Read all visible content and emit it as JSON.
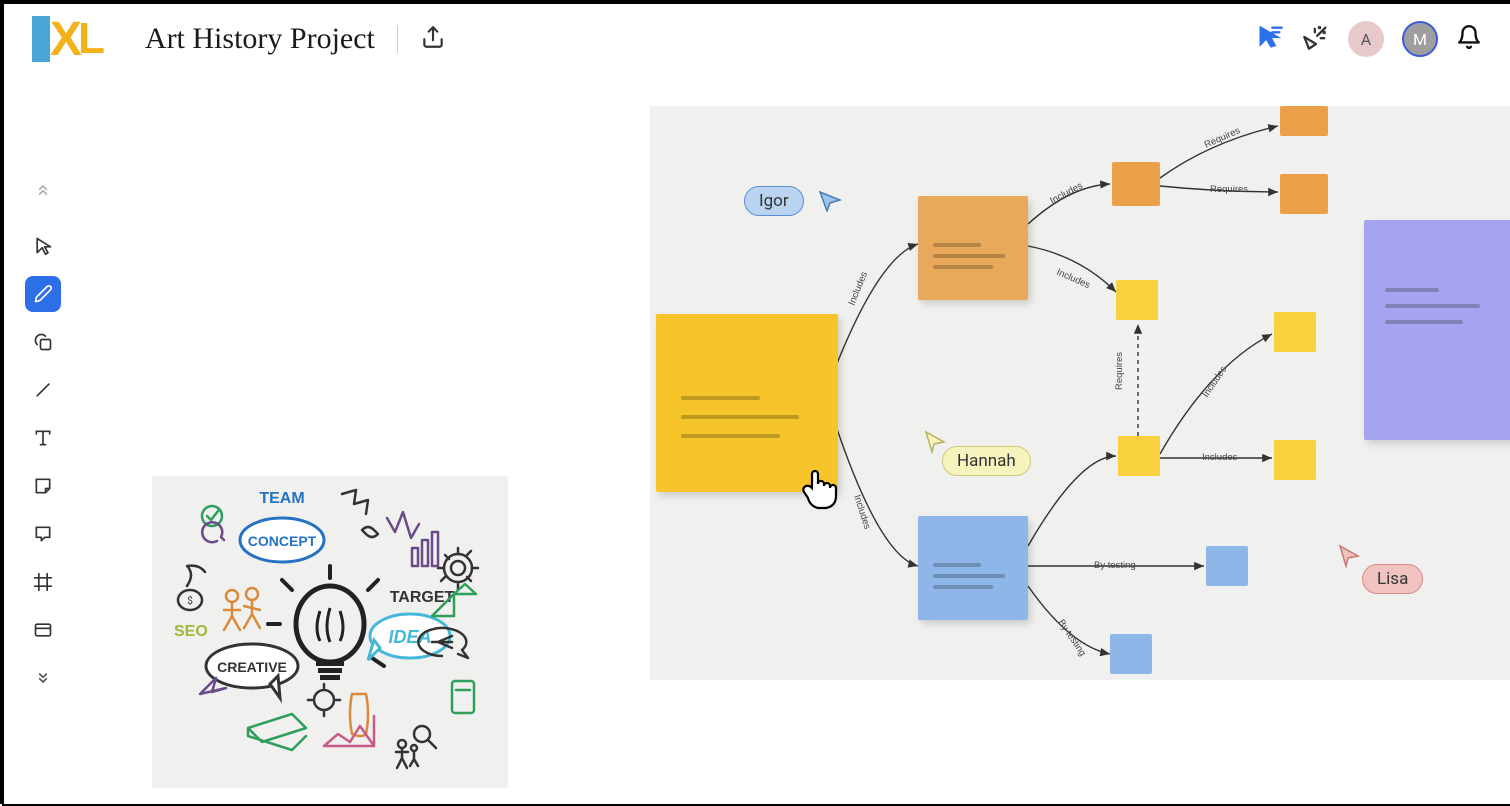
{
  "header": {
    "title": "Art History Project",
    "avatars": [
      "A",
      "M"
    ]
  },
  "sidebar": {
    "tools": [
      "select",
      "draw",
      "shape",
      "line",
      "text",
      "sticky",
      "comment",
      "frame",
      "section",
      "more"
    ]
  },
  "diagram": {
    "users": {
      "igor": "Igor",
      "hannah": "Hannah",
      "lisa": "Lisa"
    },
    "edge_labels": {
      "includes": "Includes",
      "requires": "Requires",
      "by_testing": "By testing"
    }
  },
  "brainstorm": {
    "words": {
      "team": "TEAM",
      "concept": "CONCEPT",
      "target": "TARGET",
      "idea": "IDEA",
      "creative": "CREATIVE",
      "seo": "SEO"
    }
  }
}
